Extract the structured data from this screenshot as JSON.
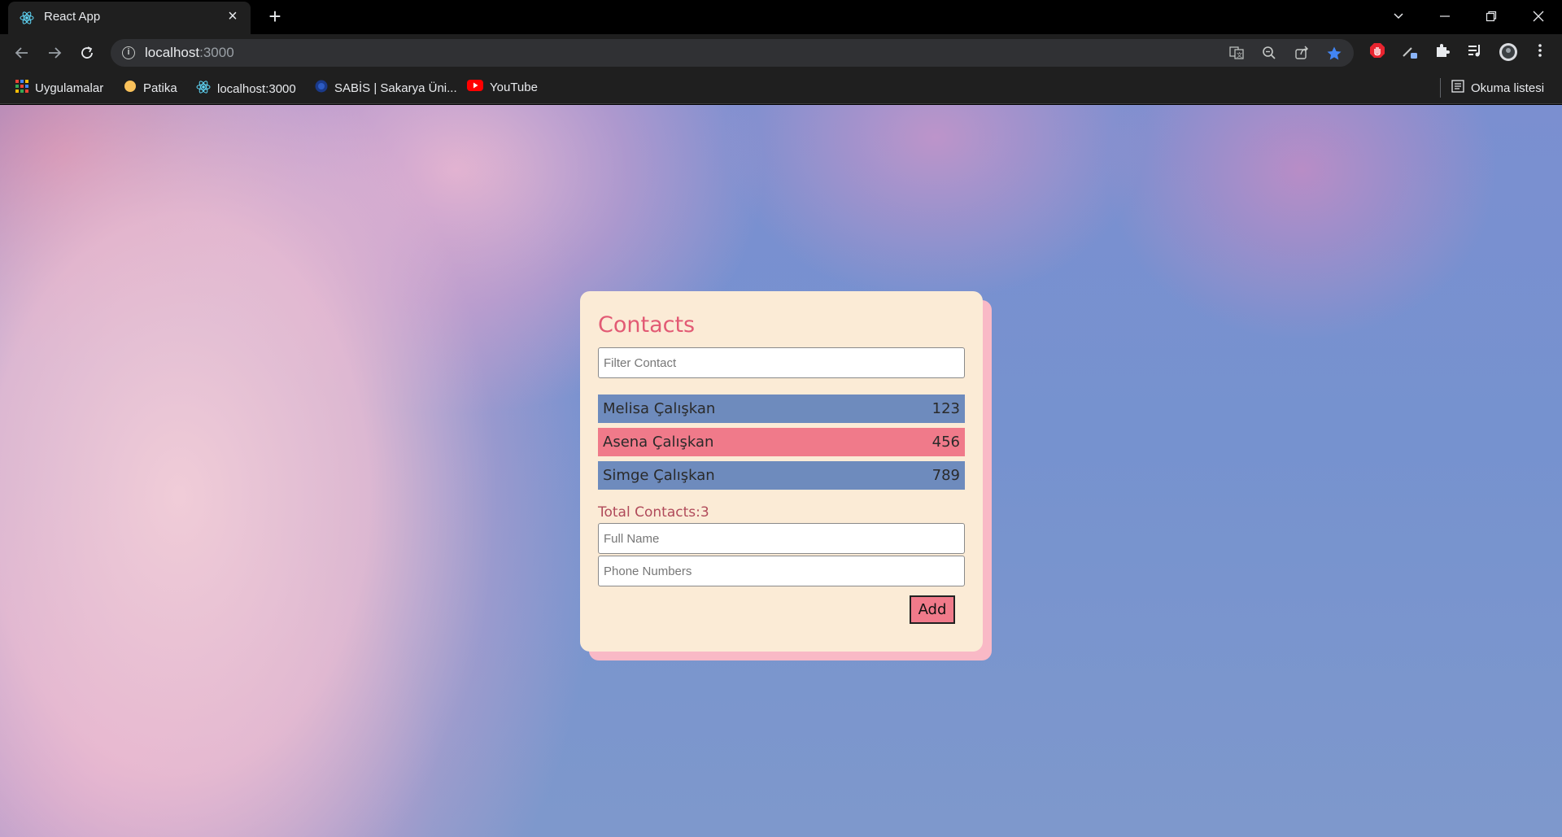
{
  "browser": {
    "tab": {
      "title": "React App"
    },
    "address": {
      "host": "localhost",
      "port": ":3000"
    },
    "bookmarks": [
      {
        "label": "Uygulamalar",
        "icon": "apps-grid-icon"
      },
      {
        "label": "Patika",
        "icon": "patika-icon"
      },
      {
        "label": "localhost:3000",
        "icon": "react-icon"
      },
      {
        "label": "SABİS | Sakarya Üni...",
        "icon": "sakarya-icon"
      },
      {
        "label": "YouTube",
        "icon": "youtube-icon"
      }
    ],
    "reading_list": {
      "label": "Okuma listesi",
      "icon": "reading-list-icon"
    }
  },
  "app": {
    "title": "Contacts",
    "filter_placeholder": "Filter Contact",
    "contacts": [
      {
        "name": "Melisa Çalışkan",
        "phone": "123",
        "color": "#6e8bbd"
      },
      {
        "name": "Asena Çalışkan",
        "phone": "456",
        "color": "#f07a8a"
      },
      {
        "name": "Simge Çalışkan",
        "phone": "789",
        "color": "#6e8bbd"
      }
    ],
    "total_label": "Total Contacts:3",
    "fullname_placeholder": "Full Name",
    "phone_placeholder": "Phone Numbers",
    "add_label": "Add"
  },
  "colors": {
    "accent": "#e25a74",
    "card_background": "#fbebd6",
    "card_shadow": "#f9b9c6"
  }
}
